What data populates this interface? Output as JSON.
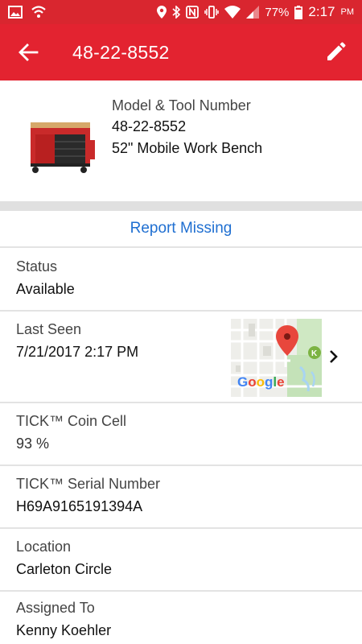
{
  "status_bar": {
    "battery": "77%",
    "time": "2:17",
    "ampm": "PM",
    "icons": [
      "image-icon",
      "vpn-shield-icon",
      "location-icon",
      "bluetooth-icon",
      "nfc-icon",
      "vibrate-icon",
      "wifi-icon",
      "signal-icon",
      "battery-icon"
    ]
  },
  "app_bar": {
    "title": "48-22-8552",
    "colors": {
      "primary": "#e32330",
      "status": "#d9262f"
    }
  },
  "product": {
    "label": "Model & Tool Number",
    "number": "48-22-8552",
    "name": "52\" Mobile Work Bench"
  },
  "actions": {
    "report_missing": "Report Missing",
    "link_color": "#1f6fd1"
  },
  "details": {
    "status": {
      "label": "Status",
      "value": "Available"
    },
    "last_seen": {
      "label": "Last Seen",
      "value": "7/21/2017 2:17 PM",
      "map_brand": "Google"
    },
    "coin_cell": {
      "label": "TICK™ Coin Cell",
      "value": "93 %"
    },
    "serial": {
      "label": "TICK™ Serial Number",
      "value": "H69A9165191394A"
    },
    "location": {
      "label": "Location",
      "value": "Carleton Circle"
    },
    "assigned_to": {
      "label": "Assigned To",
      "value": "Kenny Koehler"
    }
  }
}
